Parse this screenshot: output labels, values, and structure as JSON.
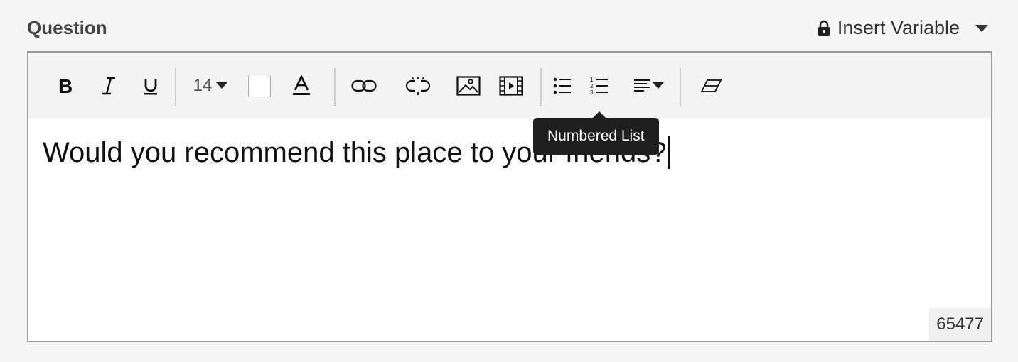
{
  "field": {
    "label": "Question"
  },
  "insert_variable": {
    "label": "Insert Variable"
  },
  "toolbar": {
    "font_size": "14",
    "tooltip": "Numbered List",
    "icons": [
      "bold-icon",
      "italic-icon",
      "underline-icon",
      "font-size-dropdown",
      "text-background-color-swatch",
      "text-color-icon",
      "link-icon",
      "unlink-icon",
      "image-icon",
      "video-icon",
      "bulleted-list-icon",
      "numbered-list-icon",
      "align-dropdown",
      "clear-formatting-icon"
    ]
  },
  "editor": {
    "content": "Would you recommend this place to your friends?",
    "counter": "65477"
  }
}
